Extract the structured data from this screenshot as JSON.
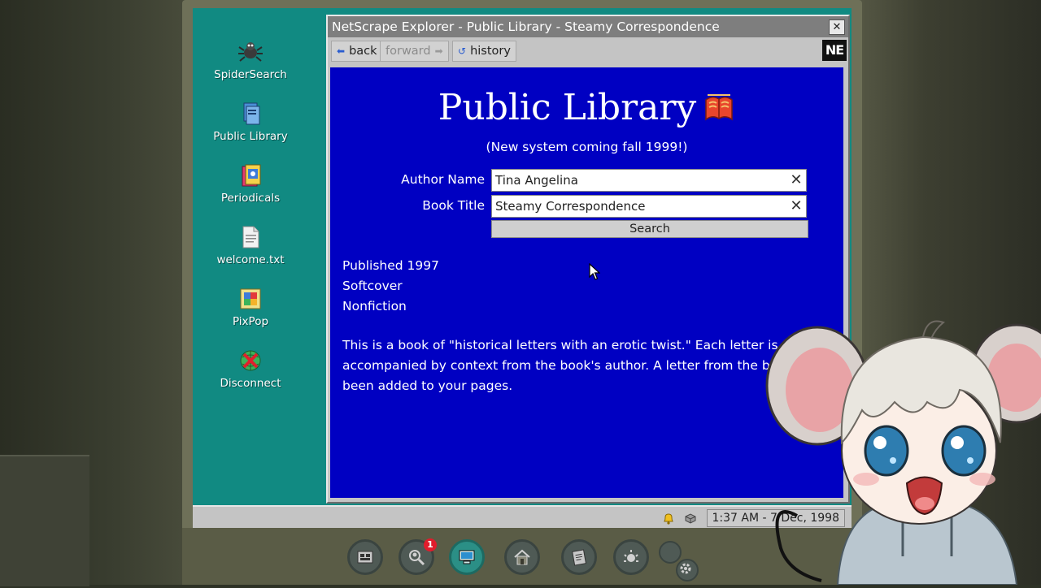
{
  "browser": {
    "title": "NetScrape Explorer - Public Library - Steamy Correspondence",
    "close_glyph": "✕",
    "toolbar": {
      "back_label": "back",
      "forward_label": "forward",
      "history_label": "history",
      "logo_text": "NE"
    }
  },
  "page": {
    "title": "Public Library",
    "subtitle": "(New system coming fall 1999!)",
    "author_label": "Author Name",
    "author_value": "Tina Angelina",
    "title_label": "Book Title",
    "title_value": "Steamy Correspondence",
    "clear_glyph": "✕",
    "search_label": "Search",
    "details": [
      "Published 1997",
      "Softcover",
      "Nonfiction"
    ],
    "description": "This is a book of \"historical letters with an erotic twist.\" Each letter is accompanied by context from the book's author. A letter from the book has been added to your pages."
  },
  "desktop": {
    "icons": [
      {
        "label": "SpiderSearch",
        "icon": "spider-icon"
      },
      {
        "label": "Public Library",
        "icon": "books-icon"
      },
      {
        "label": "Periodicals",
        "icon": "magazine-icon"
      },
      {
        "label": "welcome.txt",
        "icon": "text-file-icon"
      },
      {
        "label": "PixPop",
        "icon": "paint-icon"
      },
      {
        "label": "Disconnect",
        "icon": "globe-disconnect-icon"
      }
    ]
  },
  "taskbar": {
    "clock": "1:37 AM - 7 Dec, 1998"
  },
  "hud": {
    "notification_count": "1"
  },
  "colors": {
    "desktop_bg": "#118a82",
    "page_bg": "#0000c2",
    "window_chrome": "#c4c4c4",
    "titlebar": "#7e7e7e"
  }
}
